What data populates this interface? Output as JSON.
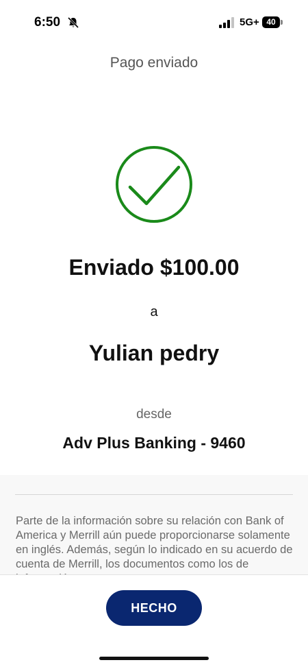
{
  "status_bar": {
    "time": "6:50",
    "network": "5G+",
    "battery": "40",
    "icons": [
      "bell-slash-icon",
      "signal-icon",
      "battery-icon"
    ]
  },
  "header": {
    "title": "Pago enviado"
  },
  "confirmation": {
    "icon": "checkmark-circle-icon",
    "sent_line": "Enviado $100.00",
    "to_word": "a",
    "recipient": "Yulian pedry",
    "from_word": "desde",
    "account": "Adv Plus Banking - 9460"
  },
  "disclaimer": {
    "text": "Parte de la información sobre su relación con Bank of America y Merrill aún puede proporcionarse solamente en inglés. Además, según lo indicado en su acuerdo de cuenta de Merrill, los documentos como los de información y otros"
  },
  "actions": {
    "done_label": "HECHO"
  },
  "colors": {
    "success": "#1a8a1a",
    "button": "#0a2770"
  }
}
